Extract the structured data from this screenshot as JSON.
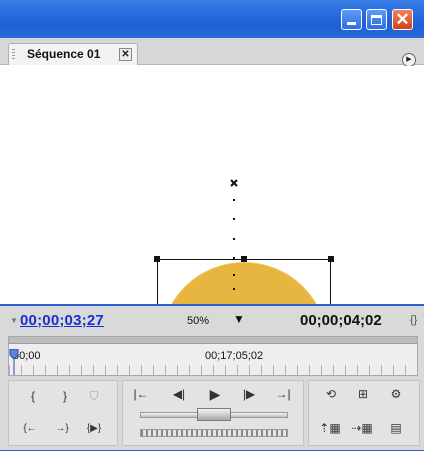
{
  "window": {
    "controls": [
      "minimize-icon",
      "maximize-icon",
      "close-icon"
    ]
  },
  "tab": {
    "label": "Séquence 01",
    "close_glyph": "✕"
  },
  "monitor": {
    "zoom": "50%"
  },
  "timecodes": {
    "current": "00;00;03;27",
    "duration": "00;00;04;02"
  },
  "ruler": {
    "start": "00;00",
    "mid": "00;17;05;02"
  },
  "colors": {
    "titlebar": "#2a6ee0",
    "accent_timecode": "#1a2fd0",
    "panel": "#d9d9d9"
  },
  "icons": {
    "monitor": [
      "anchor-point-icon",
      "motion-path-icon",
      "bounding-box-handle-icon"
    ],
    "left_panel": [
      "mark-in-icon",
      "mark-out-icon",
      "set-marker-icon",
      "go-to-in-icon",
      "go-to-out-icon",
      "play-in-to-out-icon"
    ],
    "center_panel": [
      "step-to-in-icon",
      "step-back-icon",
      "play-icon",
      "step-forward-icon",
      "step-to-out-icon",
      "jog-slider-icon",
      "shuttle-icon"
    ],
    "right_panel": [
      "loop-icon",
      "safe-margins-icon",
      "output-options-icon",
      "lift-icon",
      "extract-icon",
      "trim-icon"
    ]
  }
}
